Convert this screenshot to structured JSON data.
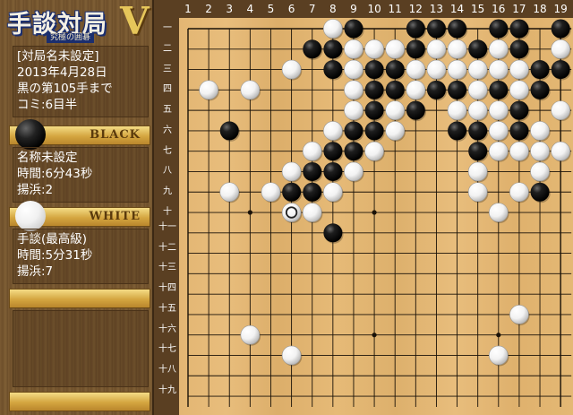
{
  "logo": {
    "title": "手談対局",
    "version": "V",
    "subtitle": "究極の囲碁"
  },
  "game_info": {
    "title": "[対局名未設定]",
    "date": "2013年4月28日",
    "progress": "黒の第105手まで",
    "komi": "コミ:6目半"
  },
  "black": {
    "label": "BLACK",
    "name": "名称未設定",
    "time": "時間:6分43秒",
    "captures": "揚浜:2"
  },
  "white": {
    "label": "WHITE",
    "name": "手談(最高級)",
    "time": "時間:5分31秒",
    "captures": "揚浜:7"
  },
  "board": {
    "size": 19,
    "col_labels": [
      "1",
      "2",
      "3",
      "4",
      "5",
      "6",
      "7",
      "8",
      "9",
      "10",
      "11",
      "12",
      "13",
      "14",
      "15",
      "16",
      "17",
      "18",
      "19"
    ],
    "row_labels": [
      "一",
      "二",
      "三",
      "四",
      "五",
      "六",
      "七",
      "八",
      "九",
      "十",
      "十一",
      "十二",
      "十三",
      "十四",
      "十五",
      "十六",
      "十七",
      "十八",
      "十九"
    ],
    "stones": [
      {
        "c": "W",
        "x": 8,
        "y": 1
      },
      {
        "c": "B",
        "x": 9,
        "y": 1
      },
      {
        "c": "B",
        "x": 12,
        "y": 1
      },
      {
        "c": "B",
        "x": 13,
        "y": 1
      },
      {
        "c": "B",
        "x": 14,
        "y": 1
      },
      {
        "c": "B",
        "x": 16,
        "y": 1
      },
      {
        "c": "B",
        "x": 17,
        "y": 1
      },
      {
        "c": "B",
        "x": 19,
        "y": 1
      },
      {
        "c": "B",
        "x": 7,
        "y": 2
      },
      {
        "c": "B",
        "x": 8,
        "y": 2
      },
      {
        "c": "W",
        "x": 9,
        "y": 2
      },
      {
        "c": "W",
        "x": 10,
        "y": 2
      },
      {
        "c": "W",
        "x": 11,
        "y": 2
      },
      {
        "c": "B",
        "x": 12,
        "y": 2
      },
      {
        "c": "W",
        "x": 13,
        "y": 2
      },
      {
        "c": "W",
        "x": 14,
        "y": 2
      },
      {
        "c": "B",
        "x": 15,
        "y": 2
      },
      {
        "c": "W",
        "x": 16,
        "y": 2
      },
      {
        "c": "B",
        "x": 17,
        "y": 2
      },
      {
        "c": "W",
        "x": 19,
        "y": 2
      },
      {
        "c": "W",
        "x": 6,
        "y": 3
      },
      {
        "c": "B",
        "x": 8,
        "y": 3
      },
      {
        "c": "W",
        "x": 9,
        "y": 3
      },
      {
        "c": "B",
        "x": 10,
        "y": 3
      },
      {
        "c": "B",
        "x": 11,
        "y": 3
      },
      {
        "c": "W",
        "x": 12,
        "y": 3
      },
      {
        "c": "W",
        "x": 13,
        "y": 3
      },
      {
        "c": "W",
        "x": 14,
        "y": 3
      },
      {
        "c": "W",
        "x": 15,
        "y": 3
      },
      {
        "c": "W",
        "x": 16,
        "y": 3
      },
      {
        "c": "W",
        "x": 17,
        "y": 3
      },
      {
        "c": "B",
        "x": 18,
        "y": 3
      },
      {
        "c": "B",
        "x": 19,
        "y": 3
      },
      {
        "c": "W",
        "x": 2,
        "y": 4
      },
      {
        "c": "W",
        "x": 4,
        "y": 4
      },
      {
        "c": "W",
        "x": 9,
        "y": 4
      },
      {
        "c": "B",
        "x": 10,
        "y": 4
      },
      {
        "c": "B",
        "x": 11,
        "y": 4
      },
      {
        "c": "W",
        "x": 12,
        "y": 4
      },
      {
        "c": "B",
        "x": 13,
        "y": 4
      },
      {
        "c": "B",
        "x": 14,
        "y": 4
      },
      {
        "c": "W",
        "x": 15,
        "y": 4
      },
      {
        "c": "B",
        "x": 16,
        "y": 4
      },
      {
        "c": "W",
        "x": 17,
        "y": 4
      },
      {
        "c": "B",
        "x": 18,
        "y": 4
      },
      {
        "c": "W",
        "x": 9,
        "y": 5
      },
      {
        "c": "B",
        "x": 10,
        "y": 5
      },
      {
        "c": "W",
        "x": 11,
        "y": 5
      },
      {
        "c": "B",
        "x": 12,
        "y": 5
      },
      {
        "c": "W",
        "x": 14,
        "y": 5
      },
      {
        "c": "W",
        "x": 15,
        "y": 5
      },
      {
        "c": "W",
        "x": 16,
        "y": 5
      },
      {
        "c": "B",
        "x": 17,
        "y": 5
      },
      {
        "c": "W",
        "x": 19,
        "y": 5
      },
      {
        "c": "B",
        "x": 3,
        "y": 6
      },
      {
        "c": "W",
        "x": 8,
        "y": 6
      },
      {
        "c": "B",
        "x": 9,
        "y": 6
      },
      {
        "c": "B",
        "x": 10,
        "y": 6
      },
      {
        "c": "W",
        "x": 11,
        "y": 6
      },
      {
        "c": "B",
        "x": 14,
        "y": 6
      },
      {
        "c": "B",
        "x": 15,
        "y": 6
      },
      {
        "c": "W",
        "x": 16,
        "y": 6
      },
      {
        "c": "B",
        "x": 17,
        "y": 6
      },
      {
        "c": "W",
        "x": 18,
        "y": 6
      },
      {
        "c": "W",
        "x": 7,
        "y": 7
      },
      {
        "c": "B",
        "x": 8,
        "y": 7
      },
      {
        "c": "B",
        "x": 9,
        "y": 7
      },
      {
        "c": "W",
        "x": 10,
        "y": 7
      },
      {
        "c": "B",
        "x": 15,
        "y": 7
      },
      {
        "c": "W",
        "x": 16,
        "y": 7
      },
      {
        "c": "W",
        "x": 17,
        "y": 7
      },
      {
        "c": "W",
        "x": 18,
        "y": 7
      },
      {
        "c": "W",
        "x": 19,
        "y": 7
      },
      {
        "c": "W",
        "x": 6,
        "y": 8
      },
      {
        "c": "B",
        "x": 7,
        "y": 8
      },
      {
        "c": "B",
        "x": 8,
        "y": 8
      },
      {
        "c": "W",
        "x": 9,
        "y": 8
      },
      {
        "c": "W",
        "x": 15,
        "y": 8
      },
      {
        "c": "W",
        "x": 18,
        "y": 8
      },
      {
        "c": "W",
        "x": 3,
        "y": 9
      },
      {
        "c": "W",
        "x": 5,
        "y": 9
      },
      {
        "c": "B",
        "x": 6,
        "y": 9
      },
      {
        "c": "B",
        "x": 7,
        "y": 9
      },
      {
        "c": "W",
        "x": 8,
        "y": 9
      },
      {
        "c": "W",
        "x": 15,
        "y": 9
      },
      {
        "c": "W",
        "x": 17,
        "y": 9
      },
      {
        "c": "B",
        "x": 18,
        "y": 9
      },
      {
        "c": "W",
        "x": 6,
        "y": 10,
        "last": true
      },
      {
        "c": "W",
        "x": 7,
        "y": 10
      },
      {
        "c": "W",
        "x": 16,
        "y": 10
      },
      {
        "c": "B",
        "x": 8,
        "y": 11
      },
      {
        "c": "W",
        "x": 17,
        "y": 15
      },
      {
        "c": "W",
        "x": 4,
        "y": 16
      },
      {
        "c": "W",
        "x": 6,
        "y": 17
      },
      {
        "c": "W",
        "x": 16,
        "y": 17
      }
    ]
  },
  "colors": {
    "black_stone": "#111111",
    "white_stone": "#f4f4f4",
    "grid": "#1a1208",
    "panel_bar": "#d4a640"
  }
}
